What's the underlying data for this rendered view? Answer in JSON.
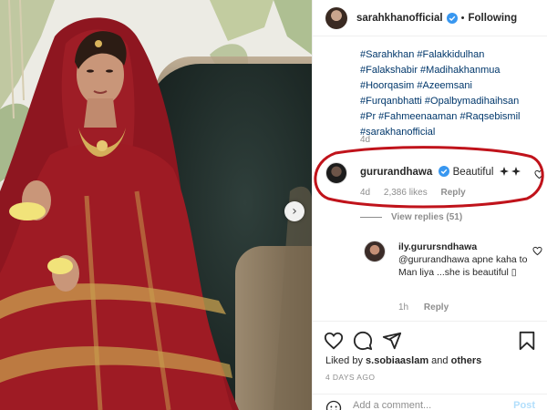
{
  "post": {
    "username": "sarahkhanofficial",
    "follow_state": "Following",
    "separator": "•",
    "hashtags": [
      "#Sarahkhan #Falakkidulhan",
      "#Falakshabir #Madihakhanmua",
      "#Hoorqasim #Azeemsani",
      "#Furqanbhatti #Opalbymadihaihsan",
      "#Pr #Fahmeenaaman #Raqsebismil",
      "#sarakhanofficial"
    ],
    "caption_age": "4d"
  },
  "comment": {
    "username": "gururandhawa",
    "text": "Beautiful",
    "age": "4d",
    "likes": "2,386 likes",
    "reply_label": "Reply"
  },
  "view_replies": "View replies (51)",
  "reply": {
    "username": "ily.gurursndhawa",
    "text": "@gururandhawa apne kaha to Man liya ...she is beautiful ▯",
    "age": "1h",
    "reply_label": "Reply"
  },
  "likes_line": {
    "prefix": "Liked by ",
    "user": "s.sobiaaslam",
    "middle": " and ",
    "others": "others"
  },
  "post_date": "4 DAYS AGO",
  "add_comment": {
    "placeholder": "Add a comment...",
    "post_label": "Post"
  },
  "carousel_next": "›",
  "colors": {
    "link": "#00376b",
    "meta": "#8e8e8e",
    "verified": "#3897f0",
    "annotation": "#c0131b",
    "dress": "#9e1b24"
  },
  "icons": [
    "verified-badge-icon",
    "heart-icon",
    "comment-icon",
    "share-icon",
    "bookmark-icon",
    "emoji-icon",
    "chevron-right-icon"
  ]
}
